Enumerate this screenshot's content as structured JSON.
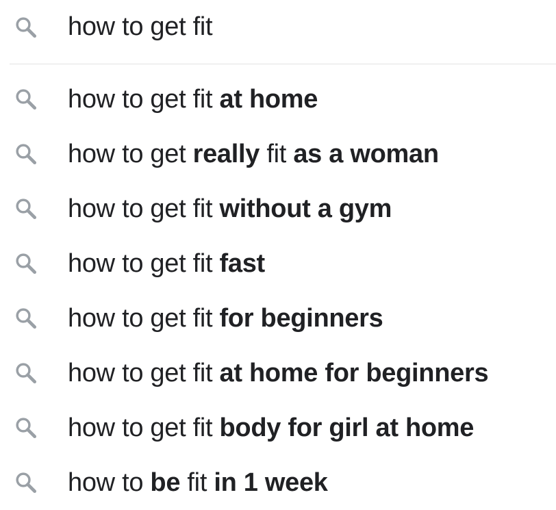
{
  "search": {
    "icon": "search-icon",
    "query": "how to get fit"
  },
  "colors": {
    "icon": "#9aa0a6",
    "text": "#202124",
    "divider": "#e3e3e3"
  },
  "suggestions": [
    {
      "icon": "search-icon",
      "parts": [
        {
          "text": "how to get fit ",
          "bold": false
        },
        {
          "text": "at home",
          "bold": true
        }
      ]
    },
    {
      "icon": "search-icon",
      "parts": [
        {
          "text": "how to get ",
          "bold": false
        },
        {
          "text": "really",
          "bold": true
        },
        {
          "text": " fit ",
          "bold": false
        },
        {
          "text": "as a woman",
          "bold": true
        }
      ]
    },
    {
      "icon": "search-icon",
      "parts": [
        {
          "text": "how to get fit ",
          "bold": false
        },
        {
          "text": "without a gym",
          "bold": true
        }
      ]
    },
    {
      "icon": "search-icon",
      "parts": [
        {
          "text": "how to get fit ",
          "bold": false
        },
        {
          "text": "fast",
          "bold": true
        }
      ]
    },
    {
      "icon": "search-icon",
      "parts": [
        {
          "text": "how to get fit ",
          "bold": false
        },
        {
          "text": "for beginners",
          "bold": true
        }
      ]
    },
    {
      "icon": "search-icon",
      "parts": [
        {
          "text": "how to get fit ",
          "bold": false
        },
        {
          "text": "at home for beginners",
          "bold": true
        }
      ]
    },
    {
      "icon": "search-icon",
      "parts": [
        {
          "text": "how to get fit ",
          "bold": false
        },
        {
          "text": "body for girl at home",
          "bold": true
        }
      ]
    },
    {
      "icon": "search-icon",
      "parts": [
        {
          "text": "how to ",
          "bold": false
        },
        {
          "text": "be",
          "bold": true
        },
        {
          "text": " fit ",
          "bold": false
        },
        {
          "text": "in 1 week",
          "bold": true
        }
      ]
    }
  ]
}
